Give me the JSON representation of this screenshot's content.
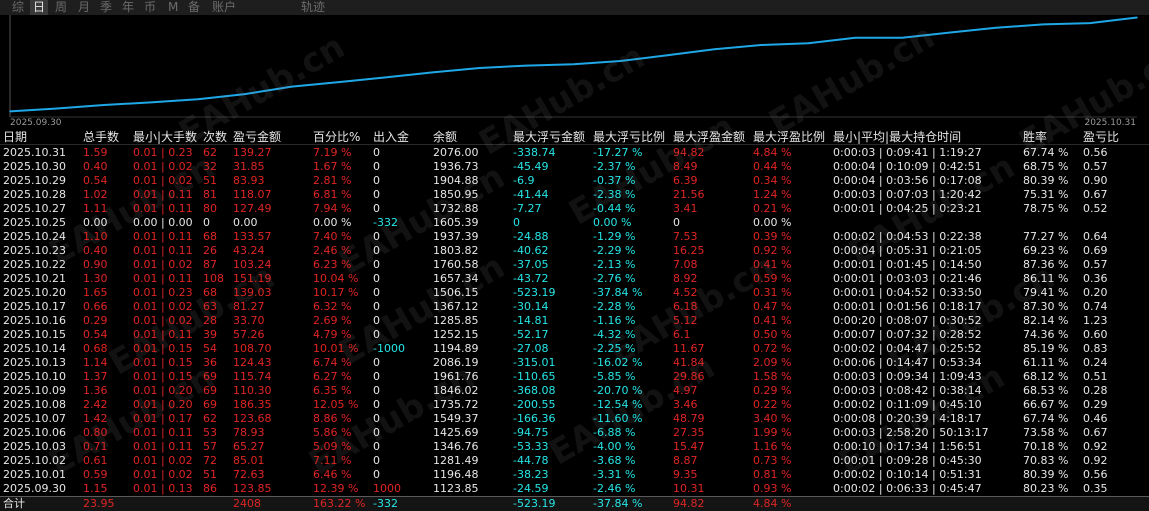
{
  "tabs": [
    "综",
    "日",
    "周",
    "月",
    "季",
    "年",
    "币",
    "M",
    "备",
    "账户",
    "轨迹"
  ],
  "active_tab": "日",
  "chart_data": {
    "type": "line",
    "x": [
      "2025.09.30",
      "2025.10.01",
      "2025.10.02",
      "2025.10.03",
      "2025.10.06",
      "2025.10.07",
      "2025.10.08",
      "2025.10.09",
      "2025.10.10",
      "2025.10.13",
      "2025.10.14",
      "2025.10.15",
      "2025.10.16",
      "2025.10.17",
      "2025.10.20",
      "2025.10.21",
      "2025.10.22",
      "2025.10.23",
      "2025.10.24",
      "2025.10.25",
      "2025.10.27",
      "2025.10.28",
      "2025.10.29",
      "2025.10.30",
      "2025.10.31"
    ],
    "values": [
      1123.85,
      1196.48,
      1281.49,
      1346.76,
      1425.69,
      1549.37,
      1735.72,
      1846.02,
      1961.76,
      2086.19,
      2194.5,
      2252.5,
      2285.8,
      2367.1,
      2506.2,
      2657.3,
      2760.6,
      2803.8,
      2937.4,
      2937.4,
      3064.9,
      3182.9,
      3266.8,
      3298.6,
      3437.8
    ],
    "color": "#1fa7e6",
    "x_start_label": "2025.09.30",
    "x_end_label": "2025.10.31"
  },
  "header": [
    "日期",
    "总手数",
    "最小|大手数",
    "次数",
    "盈亏金额",
    "百分比%",
    "出入金",
    "余额",
    "最大浮亏金额",
    "最大浮亏比例",
    "最大浮盈金额",
    "最大浮盈比例",
    "最小|平均|最大持仓时间",
    "胜率",
    "盈亏比"
  ],
  "rows": [
    [
      "2025.10.31",
      "1.59",
      "0.01 | 0.23",
      "62",
      "139.27",
      "7.19 %",
      "0",
      "2076.00",
      "-338.74",
      "-17.27 %",
      "94.82",
      "4.84 %",
      "00:00:03 | 0:09:41 | 1:19:27",
      "67.74 %",
      "0.56"
    ],
    [
      "2025.10.30",
      "0.40",
      "0.01 | 0.02",
      "32",
      "31.85",
      "1.67 %",
      "0",
      "1936.73",
      "-45.49",
      "-2.37 %",
      "8.49",
      "0.44 %",
      "00:00:04 | 0:10:09 | 0:42:51",
      "68.75 %",
      "0.57"
    ],
    [
      "2025.10.29",
      "0.54",
      "0.01 | 0.02",
      "51",
      "83.93",
      "2.81 %",
      "0",
      "1904.88",
      "-6.9",
      "-0.37 %",
      "6.39",
      "0.34 %",
      "00:00:04 | 0:03:56 | 0:17:08",
      "80.39 %",
      "0.90"
    ],
    [
      "2025.10.28",
      "1.02",
      "0.01 | 0.11",
      "81",
      "118.07",
      "6.81 %",
      "0",
      "1850.95",
      "-41.44",
      "-2.38 %",
      "21.56",
      "1.24 %",
      "00:00:03 | 0:07:03 | 1:20:42",
      "75.31 %",
      "0.67"
    ],
    [
      "2025.10.27",
      "1.11",
      "0.01 | 0.11",
      "80",
      "127.49",
      "7.94 %",
      "0",
      "1732.88",
      "-7.27",
      "-0.44 %",
      "3.41",
      "0.21 %",
      "00:00:01 | 0:04:25 | 0:23:21",
      "78.75 %",
      "0.52"
    ],
    [
      "2025.10.25",
      "0.00",
      "0.00 | 0.00",
      "0",
      "0.00",
      "0.00 %",
      "-332",
      "1605.39",
      "0",
      "0.00 %",
      "0",
      "0.00 %",
      "",
      "",
      ""
    ],
    [
      "2025.10.24",
      "1.10",
      "0.01 | 0.11",
      "68",
      "133.57",
      "7.40 %",
      "0",
      "1937.39",
      "-24.88",
      "-1.29 %",
      "7.53",
      "0.39 %",
      "00:00:02 | 0:04:53 | 0:22:38",
      "77.27 %",
      "0.64"
    ],
    [
      "2025.10.23",
      "0.40",
      "0.01 | 0.11",
      "26",
      "43.24",
      "2.46 %",
      "0",
      "1803.82",
      "-40.62",
      "-2.29 %",
      "16.25",
      "0.92 %",
      "00:00:04 | 0:05:31 | 0:21:05",
      "69.23 %",
      "0.69"
    ],
    [
      "2025.10.22",
      "0.90",
      "0.01 | 0.02",
      "87",
      "103.24",
      "6.23 %",
      "0",
      "1760.58",
      "-37.05",
      "-2.13 %",
      "7.08",
      "0.41 %",
      "00:00:01 | 0:01:45 | 0:14:50",
      "87.36 %",
      "0.57"
    ],
    [
      "2025.10.21",
      "1.30",
      "0.01 | 0.11",
      "108",
      "151.19",
      "10.04 %",
      "0",
      "1657.34",
      "-43.72",
      "-2.76 %",
      "8.92",
      "0.59 %",
      "00:00:01 | 0:03:03 | 0:21:46",
      "86.11 %",
      "0.36"
    ],
    [
      "2025.10.20",
      "1.65",
      "0.01 | 0.23",
      "68",
      "139.03",
      "10.17 %",
      "0",
      "1506.15",
      "-523.19",
      "-37.84 %",
      "4.52",
      "0.31 %",
      "00:00:01 | 0:04:52 | 0:33:50",
      "79.41 %",
      "0.20"
    ],
    [
      "2025.10.17",
      "0.66",
      "0.01 | 0.02",
      "63",
      "81.27",
      "6.32 %",
      "0",
      "1367.12",
      "-30.14",
      "-2.28 %",
      "6.18",
      "0.47 %",
      "00:00:01 | 0:01:56 | 0:18:17",
      "87.30 %",
      "0.74"
    ],
    [
      "2025.10.16",
      "0.29",
      "0.01 | 0.02",
      "28",
      "33.70",
      "2.69 %",
      "0",
      "1285.85",
      "-14.81",
      "-1.16 %",
      "5.12",
      "0.41 %",
      "00:00:20 | 0:08:07 | 0:30:52",
      "82.14 %",
      "1.23"
    ],
    [
      "2025.10.15",
      "0.54",
      "0.01 | 0.11",
      "39",
      "57.26",
      "4.79 %",
      "0",
      "1252.15",
      "-52.17",
      "-4.32 %",
      "6.1",
      "0.50 %",
      "00:00:07 | 0:07:32 | 0:28:52",
      "74.36 %",
      "0.60"
    ],
    [
      "2025.10.14",
      "0.68",
      "0.01 | 0.15",
      "54",
      "108.70",
      "10.01 %",
      "-1000",
      "1194.89",
      "-27.08",
      "-2.25 %",
      "11.67",
      "0.72 %",
      "00:00:02 | 0:04:47 | 0:25:52",
      "85.19 %",
      "0.83"
    ],
    [
      "2025.10.13",
      "1.14",
      "0.01 | 0.15",
      "36",
      "124.43",
      "6.74 %",
      "0",
      "2086.19",
      "-315.01",
      "-16.02 %",
      "41.84",
      "2.09 %",
      "00:00:06 | 0:14:47 | 0:53:34",
      "61.11 %",
      "0.24"
    ],
    [
      "2025.10.10",
      "1.37",
      "0.01 | 0.15",
      "69",
      "115.74",
      "6.27 %",
      "0",
      "1961.76",
      "-110.65",
      "-5.85 %",
      "29.86",
      "1.58 %",
      "00:00:03 | 0:09:34 | 1:09:43",
      "68.12 %",
      "0.51"
    ],
    [
      "2025.10.09",
      "1.36",
      "0.01 | 0.20",
      "69",
      "110.30",
      "6.35 %",
      "0",
      "1846.02",
      "-368.08",
      "-20.70 %",
      "4.97",
      "0.29 %",
      "00:00:03 | 0:08:42 | 0:38:14",
      "68.53 %",
      "0.28"
    ],
    [
      "2025.10.08",
      "2.42",
      "0.01 | 0.20",
      "69",
      "186.35",
      "12.05 %",
      "0",
      "1735.72",
      "-200.55",
      "-12.54 %",
      "3.46",
      "0.22 %",
      "00:00:02 | 0:11:09 | 0:45:10",
      "66.67 %",
      "0.29"
    ],
    [
      "2025.10.07",
      "1.42",
      "0.01 | 0.17",
      "62",
      "123.68",
      "8.86 %",
      "0",
      "1549.37",
      "-166.36",
      "-11.60 %",
      "48.79",
      "3.40 %",
      "00:00:08 | 0:20:39 | 4:18:17",
      "67.74 %",
      "0.46"
    ],
    [
      "2025.10.06",
      "0.80",
      "0.01 | 0.11",
      "53",
      "78.93",
      "5.86 %",
      "0",
      "1425.69",
      "-94.75",
      "-6.88 %",
      "27.35",
      "1.99 %",
      "00:00:03 | 2:58:20 | 50:13:17",
      "73.58 %",
      "0.67"
    ],
    [
      "2025.10.03",
      "0.71",
      "0.01 | 0.11",
      "57",
      "65.27",
      "5.09 %",
      "0",
      "1346.76",
      "-53.33",
      "-4.00 %",
      "15.47",
      "1.16 %",
      "00:00:10 | 0:17:34 | 1:56:51",
      "70.18 %",
      "0.92"
    ],
    [
      "2025.10.02",
      "0.61",
      "0.01 | 0.02",
      "72",
      "85.01",
      "7.11 %",
      "0",
      "1281.49",
      "-44.78",
      "-3.68 %",
      "8.87",
      "0.73 %",
      "00:00:01 | 0:09:28 | 0:45:30",
      "70.83 %",
      "0.92"
    ],
    [
      "2025.10.01",
      "0.59",
      "0.01 | 0.02",
      "51",
      "72.63",
      "6.46 %",
      "0",
      "1196.48",
      "-38.23",
      "-3.31 %",
      "9.35",
      "0.81 %",
      "00:00:02 | 0:10:14 | 0:51:31",
      "80.39 %",
      "0.56"
    ],
    [
      "2025.09.30",
      "1.15",
      "0.01 | 0.13",
      "86",
      "123.85",
      "12.39 %",
      "1000",
      "1123.85",
      "-24.59",
      "-2.46 %",
      "10.31",
      "0.93 %",
      "00:00:02 | 0:06:33 | 0:45:47",
      "80.23 %",
      "0.35"
    ]
  ],
  "total": [
    "合计",
    "23.95",
    "",
    "",
    "2408",
    "163.22 %",
    "-332",
    "",
    "-523.19",
    "-37.84 %",
    "94.82",
    "4.84 %",
    "",
    "",
    ""
  ],
  "watermark": "EAHub.cn",
  "colors": {
    "positive": "#e02424",
    "negative": "#26e6e6",
    "neutral": "#e6e6e6",
    "line": "#1fa7e6"
  }
}
